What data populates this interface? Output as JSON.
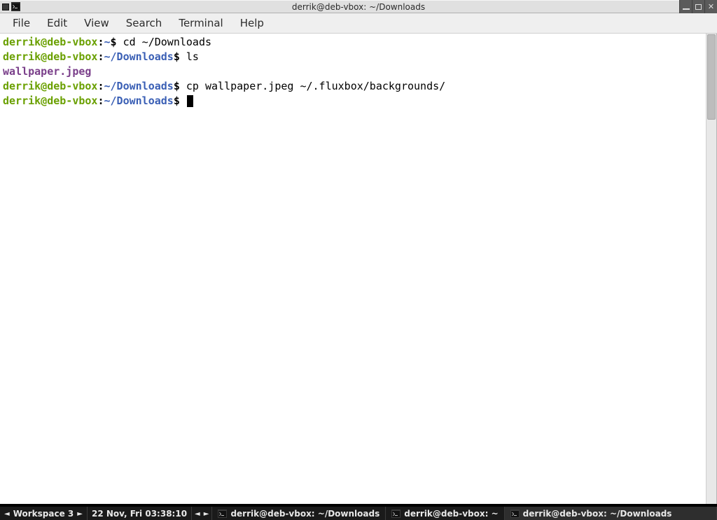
{
  "window": {
    "title": "derrik@deb-vbox: ~/Downloads"
  },
  "menubar": {
    "items": [
      "File",
      "Edit",
      "View",
      "Search",
      "Terminal",
      "Help"
    ]
  },
  "prompt": {
    "user_host": "derrik@deb-vbox",
    "path_home": "~",
    "path_downloads": "~/Downloads",
    "dollar": "$"
  },
  "terminal": {
    "lines": [
      {
        "path": "~",
        "cmd": "cd ~/Downloads"
      },
      {
        "path": "~/Downloads",
        "cmd": "ls"
      },
      {
        "output": "wallpaper.jpeg"
      },
      {
        "path": "~/Downloads",
        "cmd": "cp wallpaper.jpeg ~/.fluxbox/backgrounds/"
      },
      {
        "path": "~/Downloads",
        "cmd": "",
        "cursor": true
      }
    ]
  },
  "taskbar": {
    "workspace_label": "Workspace 3",
    "clock": "22 Nov, Fri 03:38:10",
    "tasks": [
      {
        "title": "derrik@deb-vbox: ~/Downloads",
        "active": false
      },
      {
        "title": "derrik@deb-vbox: ~",
        "active": false
      },
      {
        "title": "derrik@deb-vbox: ~/Downloads",
        "active": true
      }
    ]
  }
}
